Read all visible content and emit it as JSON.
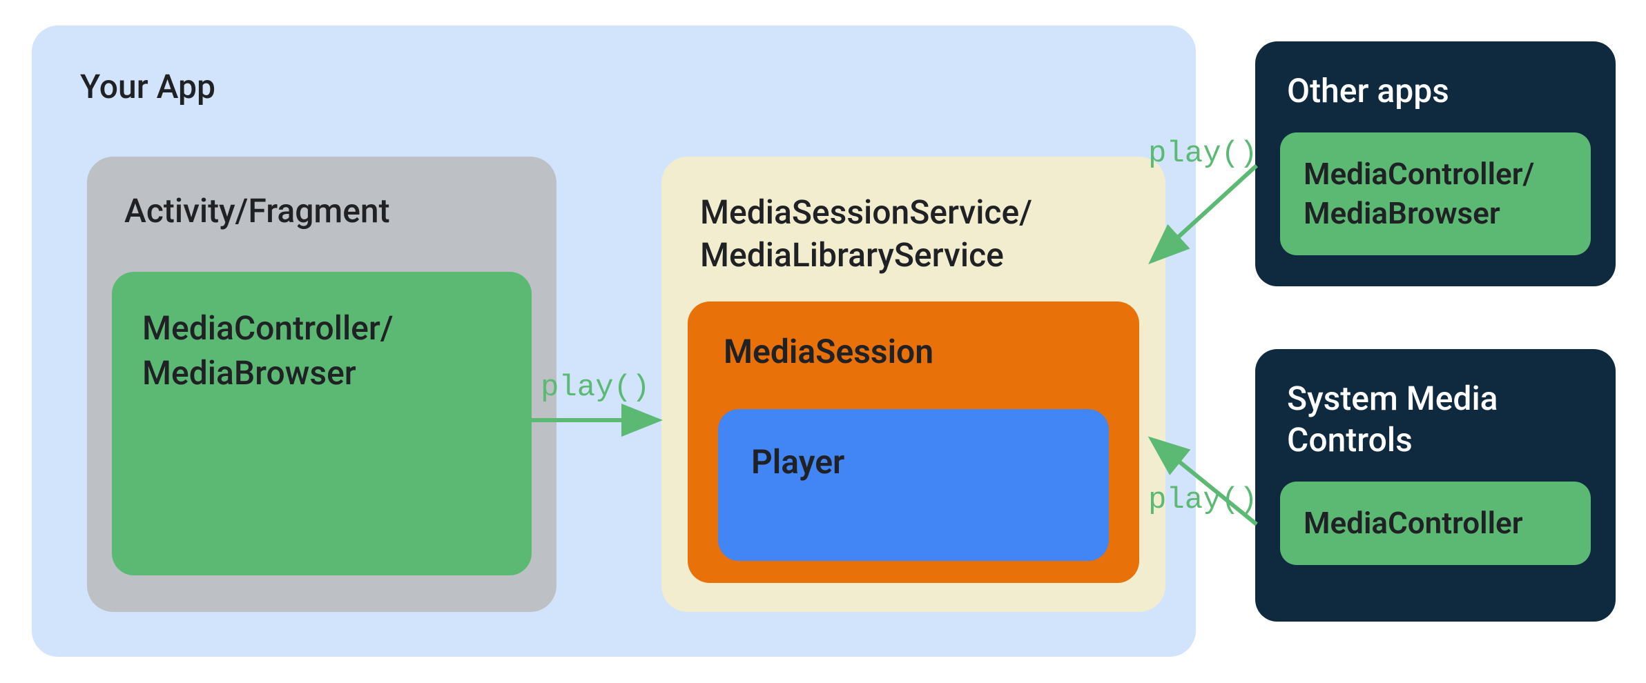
{
  "diagram": {
    "your_app": {
      "title": "Your App",
      "activity_box": {
        "title": "Activity/Fragment",
        "controller": {
          "line1": "MediaController/",
          "line2": "MediaBrowser"
        }
      },
      "service_box": {
        "title_line1": "MediaSessionService/",
        "title_line2": "MediaLibraryService",
        "media_session": {
          "title": "MediaSession",
          "player": {
            "title": "Player"
          }
        }
      }
    },
    "other_apps": {
      "title": "Other apps",
      "controller": {
        "line1": "MediaController/",
        "line2": "MediaBrowser"
      }
    },
    "system_controls": {
      "title_line1": "System Media",
      "title_line2": "Controls",
      "controller": {
        "label": "MediaController"
      }
    },
    "arrows": {
      "arrow1_label": "play()",
      "arrow2_label": "play()",
      "arrow3_label": "play()"
    }
  }
}
